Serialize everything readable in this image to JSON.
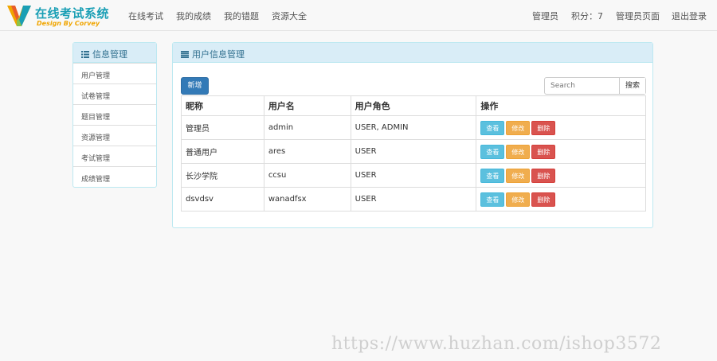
{
  "navbar": {
    "logo_title": "在线考试系统",
    "logo_subtitle": "Design By Corvey",
    "links": [
      {
        "label": "在线考试"
      },
      {
        "label": "我的成绩"
      },
      {
        "label": "我的错题"
      },
      {
        "label": "资源大全"
      }
    ],
    "user_name": "管理员",
    "points_label": "积分：7",
    "admin_page_label": "管理员页面",
    "logout_label": "退出登录"
  },
  "sidebar": {
    "title": "信息管理",
    "icon": "list-icon",
    "items": [
      {
        "label": "用户管理"
      },
      {
        "label": "试卷管理"
      },
      {
        "label": "题目管理"
      },
      {
        "label": "资源管理"
      },
      {
        "label": "考试管理"
      },
      {
        "label": "成绩管理"
      }
    ]
  },
  "main": {
    "title": "用户信息管理",
    "icon": "menu-lines-icon",
    "add_label": "新增",
    "search": {
      "placeholder": "Search",
      "value": "",
      "button_label": "搜索"
    },
    "table": {
      "headers": [
        "昵称",
        "用户名",
        "用户角色",
        "操作"
      ],
      "rows": [
        {
          "nickname": "管理员",
          "username": "admin",
          "role": "USER, ADMIN"
        },
        {
          "nickname": "普通用户",
          "username": "ares",
          "role": "USER"
        },
        {
          "nickname": "长沙学院",
          "username": "ccsu",
          "role": "USER"
        },
        {
          "nickname": "dsvdsv",
          "username": "wanadfsx",
          "role": "USER"
        }
      ],
      "actions": {
        "view": "查看",
        "edit": "修改",
        "delete": "删除"
      }
    }
  },
  "watermark": "https://www.huzhan.com/ishop3572",
  "colors": {
    "brand_teal": "#1a9fb5",
    "brand_orange": "#f0a500",
    "primary": "#337ab7",
    "info": "#5bc0de",
    "warning": "#f0ad4e",
    "danger": "#d9534f",
    "panel_head_bg": "#d9edf7"
  }
}
